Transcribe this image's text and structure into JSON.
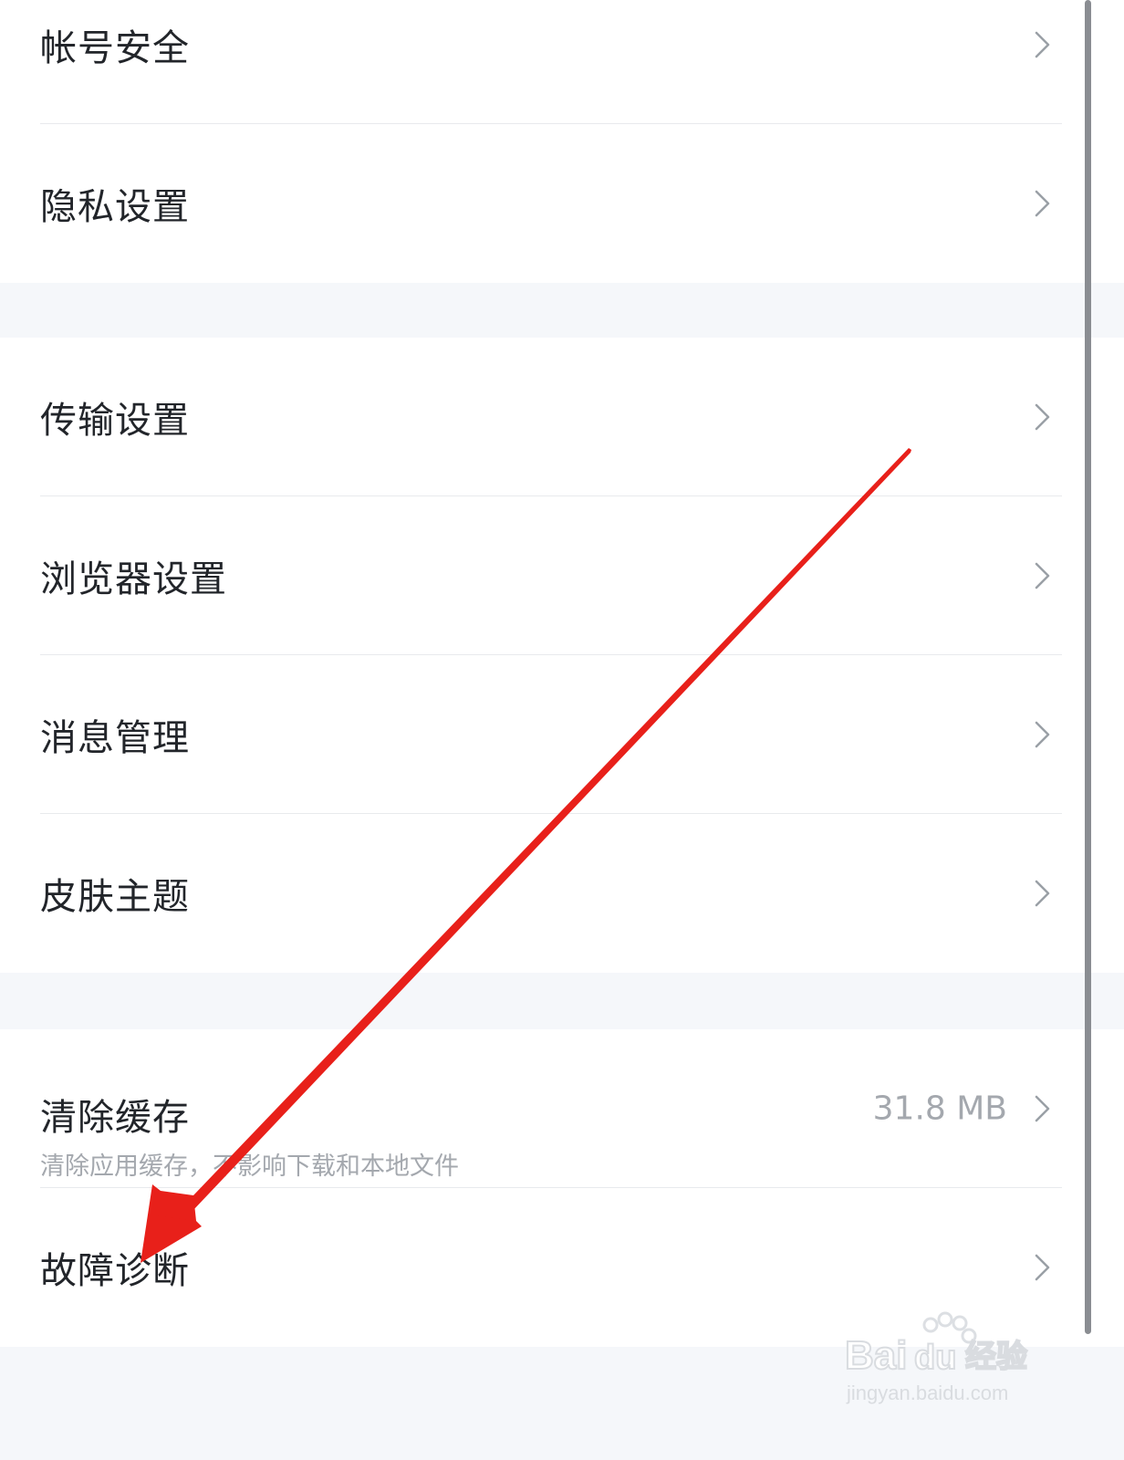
{
  "settings": {
    "group1": [
      {
        "label": "帐号安全"
      },
      {
        "label": "隐私设置"
      }
    ],
    "group2": [
      {
        "label": "传输设置"
      },
      {
        "label": "浏览器设置"
      },
      {
        "label": "消息管理"
      },
      {
        "label": "皮肤主题"
      }
    ],
    "group3": {
      "clear_cache": {
        "label": "清除缓存",
        "sublabel": "清除应用缓存，不影响下载和本地文件",
        "value": "31.8 MB"
      },
      "diagnosis": {
        "label": "故障诊断"
      }
    }
  },
  "icons": {
    "row_chevron": "chevron-right-icon"
  },
  "annotation": {
    "arrow_color": "#e8201a"
  },
  "watermark": {
    "brand": "Baidu经验",
    "url": "jingyan.baidu.com"
  },
  "colors": {
    "background": "#f5f7fa",
    "row_background": "#ffffff",
    "primary_text": "#22252a",
    "secondary_text": "#a4a8ae",
    "divider": "#e8eaed"
  }
}
